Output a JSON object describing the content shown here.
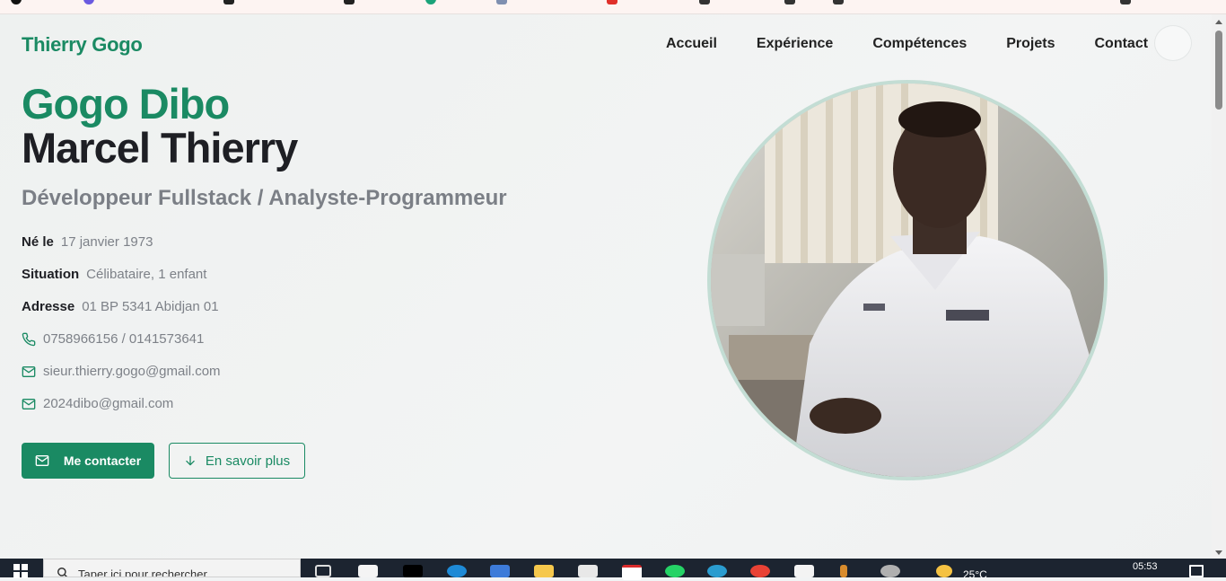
{
  "site": {
    "brand": "Thierry Gogo",
    "nav": [
      "Accueil",
      "Expérience",
      "Compétences",
      "Projets",
      "Contact"
    ]
  },
  "hero": {
    "first_name": "Gogo Dibo",
    "last_name": "Marcel Thierry",
    "role": "Développeur Fullstack / Analyste-Programmeur",
    "born_label": "Né le",
    "born_value": "17 janvier 1973",
    "situation_label": "Situation",
    "situation_value": "Célibataire, 1 enfant",
    "address_label": "Adresse",
    "address_value": "01 BP 5341 Abidjan 01",
    "phone": "0758966156 / 0141573641",
    "email1": "sieur.thierry.gogo@gmail.com",
    "email2": "2024dibo@gmail.com",
    "contact_button": "Me contacter",
    "more_button": "En savoir plus"
  },
  "taskbar": {
    "search_placeholder": "Taper ici pour rechercher",
    "temperature": "25°C",
    "time": "05:53"
  },
  "colors": {
    "accent": "#1a8a63",
    "text_dark": "#1e1f24",
    "text_muted": "#7d8188",
    "avatar_ring": "#c3ddd4"
  },
  "icons": {
    "phone": "phone-icon",
    "email": "mail-icon",
    "arrow": "arrow-down-icon"
  }
}
